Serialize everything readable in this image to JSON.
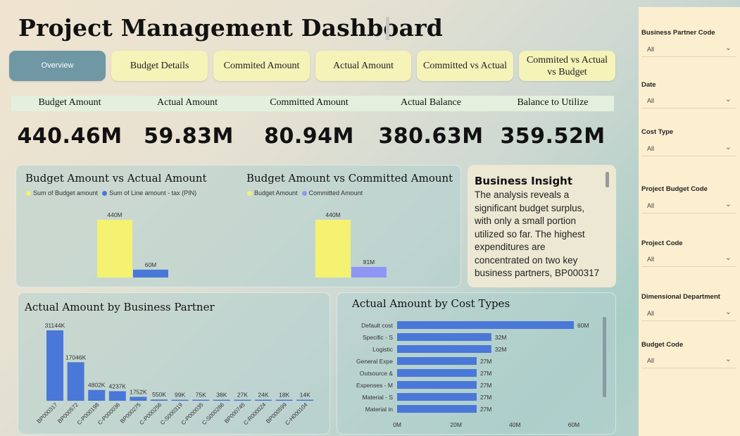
{
  "title": "Project Management Dashboard",
  "nav": [
    {
      "label": "Overview",
      "active": true
    },
    {
      "label": "Budget Details"
    },
    {
      "label": "Commited Amount"
    },
    {
      "label": "Actual Amount"
    },
    {
      "label": "Committed vs Actual"
    },
    {
      "label": "Commited vs Actual vs Budget"
    }
  ],
  "kpis": [
    {
      "label": "Budget Amount",
      "value": "440.46M"
    },
    {
      "label": "Actual Amount",
      "value": "59.83M"
    },
    {
      "label": "Committed Amount",
      "value": "80.94M"
    },
    {
      "label": "Actual Balance",
      "value": "380.63M"
    },
    {
      "label": "Balance to Utilize",
      "value": "359.52M"
    }
  ],
  "insight": {
    "title": "Business Insight",
    "text": "The analysis reveals a significant budget surplus, with only a small portion utilized so far. The highest expenditures are concentrated on two key business partners, BP000317"
  },
  "slicers": [
    {
      "label": "Business Partner Code",
      "value": "All"
    },
    {
      "label": "Date",
      "value": "All"
    },
    {
      "label": "Cost Type",
      "value": "All"
    },
    {
      "label": "Project Budget Code",
      "value": "All"
    },
    {
      "label": "Project Code",
      "value": "All"
    },
    {
      "label": "Dimensional Department",
      "value": "All"
    },
    {
      "label": "Budget Code",
      "value": "All"
    }
  ],
  "colors": {
    "yellow": "#f5f171",
    "blue": "#4a78d8",
    "periwinkle": "#8e96f5"
  },
  "chart_data": [
    {
      "type": "bar",
      "title": "Budget Amount vs Actual Amount",
      "series": [
        {
          "name": "Sum of Budget amount",
          "values": [
            440
          ],
          "label": "440M",
          "color": "#f5f171"
        },
        {
          "name": "Sum of Line amount - tax (PIN)",
          "values": [
            60
          ],
          "label": "60M",
          "color": "#4a78d8"
        }
      ],
      "ylim": [
        0,
        440
      ]
    },
    {
      "type": "bar",
      "title": "Budget Amount vs Committed Amount",
      "series": [
        {
          "name": "Budget Amount",
          "values": [
            440
          ],
          "label": "440M",
          "color": "#f5f171"
        },
        {
          "name": "Committed Amount",
          "values": [
            81
          ],
          "label": "81M",
          "color": "#8e96f5"
        }
      ],
      "ylim": [
        0,
        440
      ]
    },
    {
      "type": "bar",
      "title": "Actual Amount by Business Partner",
      "categories": [
        "BP000317",
        "BP000572",
        "C-P000198",
        "C-P000036",
        "BP000275",
        "C-P000256",
        "C-S000319",
        "C-P000035",
        "C-S000286",
        "BP000745",
        "C-R000024",
        "BP000599",
        "C-H000104"
      ],
      "values": [
        31144,
        17046,
        4802,
        4237,
        1752,
        550,
        99,
        75,
        38,
        27,
        24,
        18,
        14
      ],
      "labels": [
        "31144K",
        "17046K",
        "4802K",
        "4237K",
        "1752K",
        "550K",
        "99K",
        "75K",
        "38K",
        "27K",
        "24K",
        "18K",
        "14K"
      ],
      "unit": "K"
    },
    {
      "type": "bar",
      "orientation": "horizontal",
      "title": "Actual Amount by Cost Types",
      "categories": [
        "Default cost",
        "Specific - S",
        "Logistic",
        "General Expe",
        "Outsource &",
        "Expenses - M",
        "Material - S",
        "Material in"
      ],
      "values": [
        60,
        32,
        32,
        27,
        27,
        27,
        27,
        27
      ],
      "labels": [
        "60M",
        "32M",
        "32M",
        "27M",
        "27M",
        "27M",
        "27M",
        "27M"
      ],
      "xticks": [
        "0M",
        "20M",
        "40M",
        "60M"
      ],
      "xlim": [
        0,
        60
      ]
    }
  ]
}
